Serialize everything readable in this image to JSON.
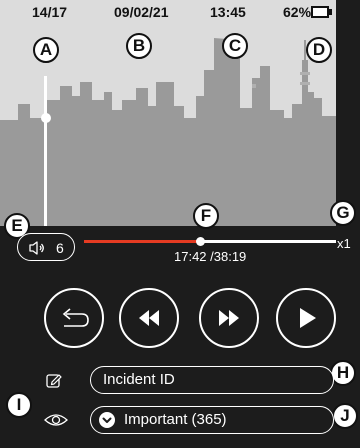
{
  "status": {
    "counter": "14/17",
    "date": "09/02/21",
    "time": "13:45",
    "battery": "62%",
    "battery_level": 0.62
  },
  "callouts": [
    "A",
    "B",
    "C",
    "D",
    "E",
    "F",
    "G",
    "H",
    "I",
    "J"
  ],
  "icons": {
    "volume": "speaker-icon",
    "back": "return-arrow-icon",
    "rewind": "rewind-icon",
    "fast_forward": "fast-forward-icon",
    "play": "play-icon",
    "edit": "pencil-square-icon",
    "visibility": "eye-icon",
    "filter_toggle": "chevron-down-icon"
  },
  "playback": {
    "volume": "6",
    "time": "17:42 /38:19",
    "progress": 0.46,
    "speed": "x1"
  },
  "vertical_slider": {
    "level": 0.75
  },
  "fields": {
    "incident_placeholder": "Incident ID",
    "filter_value": "Important (365)"
  },
  "colors": {
    "background": "#1c1c1c",
    "video_bg": "#dcdcdc",
    "skyline": "#9a9a9a",
    "progress": "#e53b22",
    "foreground": "#ffffff"
  }
}
